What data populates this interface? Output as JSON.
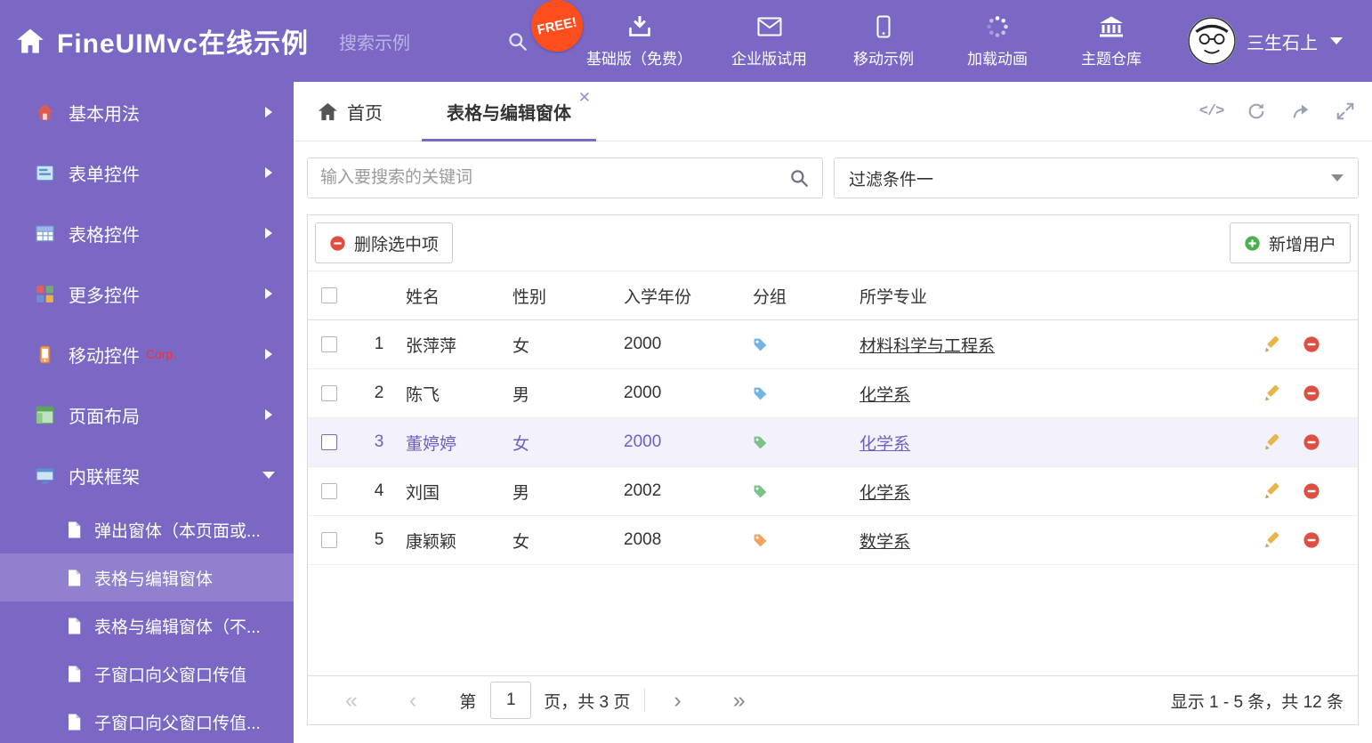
{
  "colors": {
    "purple": "#7b68c5",
    "badge_red": "#ff4e1d",
    "delete_red": "#dd4f43",
    "add_green": "#4caf50",
    "tag_blue": "#74b3e3",
    "tag_green": "#7cc08a",
    "tag_orange": "#f0a45f"
  },
  "header": {
    "title": "FineUIMvc在线示例",
    "search_placeholder": "搜索示例",
    "free_badge": "FREE!",
    "nav": [
      {
        "label": "基础版（免费）"
      },
      {
        "label": "企业版试用"
      },
      {
        "label": "移动示例"
      },
      {
        "label": "加载动画"
      },
      {
        "label": "主题仓库"
      }
    ],
    "user_name": "三生石上"
  },
  "sidebar": {
    "items": [
      {
        "label": "基本用法"
      },
      {
        "label": "表单控件"
      },
      {
        "label": "表格控件"
      },
      {
        "label": "更多控件"
      },
      {
        "label": "移动控件",
        "badge": "Corp."
      },
      {
        "label": "页面布局"
      },
      {
        "label": "内联框架"
      }
    ],
    "subitems": [
      {
        "label": "弹出窗体（本页面或..."
      },
      {
        "label": "表格与编辑窗体"
      },
      {
        "label": "表格与编辑窗体（不..."
      },
      {
        "label": "子窗口向父窗口传值"
      },
      {
        "label": "子窗口向父窗口传值..."
      }
    ]
  },
  "tabs": [
    {
      "label": "首页"
    },
    {
      "label": "表格与编辑窗体"
    }
  ],
  "filters": {
    "search_placeholder": "输入要搜索的关键词",
    "dropdown_value": "过滤条件一"
  },
  "toolbar": {
    "delete_label": "删除选中项",
    "add_label": "新增用户"
  },
  "table": {
    "columns": {
      "name": "姓名",
      "gender": "性别",
      "year": "入学年份",
      "group": "分组",
      "major": "所学专业"
    },
    "rows": [
      {
        "index": "1",
        "name": "张萍萍",
        "gender": "女",
        "year": "2000",
        "tag_color": "#74b3e3",
        "major": "材料科学与工程系"
      },
      {
        "index": "2",
        "name": "陈飞",
        "gender": "男",
        "year": "2000",
        "tag_color": "#74b3e3",
        "major": "化学系"
      },
      {
        "index": "3",
        "name": "董婷婷",
        "gender": "女",
        "year": "2000",
        "tag_color": "#7cc08a",
        "major": "化学系",
        "selected": true
      },
      {
        "index": "4",
        "name": "刘国",
        "gender": "男",
        "year": "2002",
        "tag_color": "#7cc08a",
        "major": "化学系"
      },
      {
        "index": "5",
        "name": "康颖颖",
        "gender": "女",
        "year": "2008",
        "tag_color": "#f0a45f",
        "major": "数学系"
      }
    ]
  },
  "pagination": {
    "page_label_prefix": "第",
    "page_value": "1",
    "page_label_suffix": "页，共 3 页",
    "summary": "显示 1 - 5 条，共 12 条"
  }
}
